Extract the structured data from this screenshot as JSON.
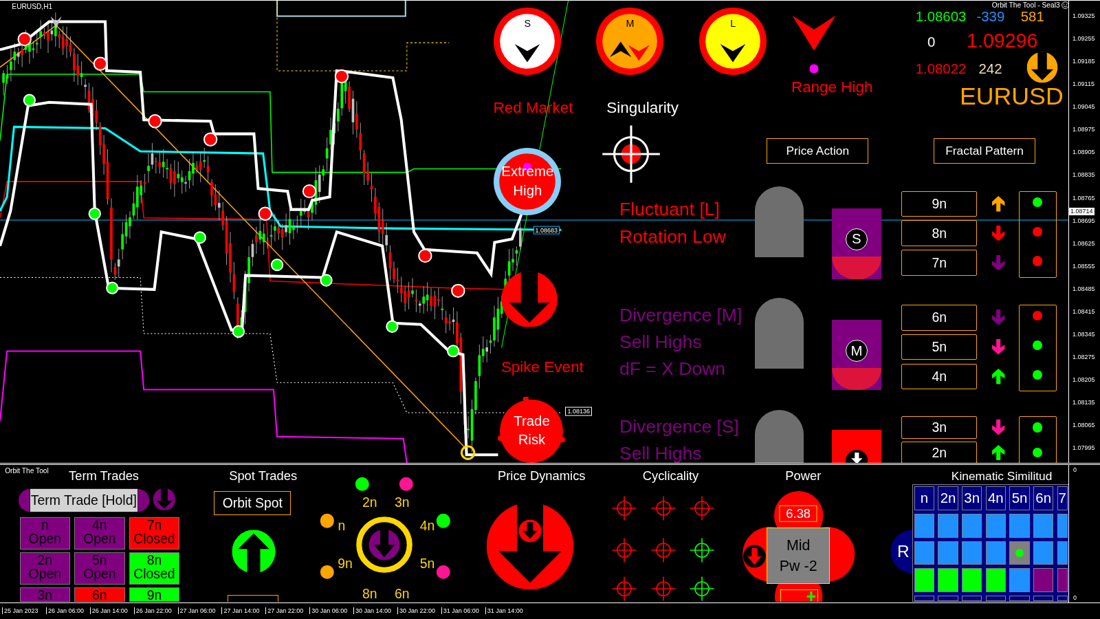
{
  "chart": {
    "title": "EURUSD,H1",
    "brand": "Orbit The Tool - Seal3",
    "price_tags": [
      "1.08683",
      "1.08136"
    ]
  },
  "dials": [
    {
      "label": "S",
      "color": "#ffffff",
      "arrows": [
        {
          "rising": false,
          "color": "#000000"
        }
      ]
    },
    {
      "label": "M",
      "color": "#ffa500",
      "arrows": [
        {
          "rising": true,
          "color": "#000000"
        },
        {
          "rising": false,
          "color": "#ff0000"
        }
      ]
    },
    {
      "label": "L",
      "color": "#ffff00",
      "arrows": [
        {
          "rising": false,
          "color": "#000000"
        }
      ]
    }
  ],
  "range_high": {
    "label": "Range High"
  },
  "captions": [
    {
      "text": "Red Market",
      "color": "#ff0000"
    },
    {
      "text": "Singularity",
      "color": "#ffffff"
    },
    {
      "text": "Spike Event",
      "color": "#ff0000"
    }
  ],
  "stats": [
    {
      "text": "1.08603",
      "color": "#00ff00"
    },
    {
      "text": "-339",
      "color": "#1e90ff"
    },
    {
      "text": "581",
      "color": "#ffa500"
    },
    {
      "text": "0",
      "color": "#ffffff"
    },
    {
      "text": "1.09296",
      "color": "#ff0000"
    },
    {
      "text": "1.08022",
      "color": "#ff0000"
    },
    {
      "text": "242",
      "color": "#f5deb3"
    }
  ],
  "symbol": {
    "name": "EURUSD",
    "rising": false
  },
  "buttons": [
    "Price Action",
    "Fractal Pattern"
  ],
  "markers": [
    {
      "text": "Extreme High",
      "kind": "ring"
    },
    {
      "text": "Trade Risk",
      "kind": "blob"
    }
  ],
  "signals": [
    {
      "lines": [
        "Fluctuant [L]",
        "Rotation Low"
      ],
      "color": "#ff0000",
      "badge": {
        "letter": "S",
        "color": "#800080"
      },
      "levels": [
        {
          "label": "9n",
          "arrow": {
            "rising": true,
            "color": "#ffa500"
          },
          "dot": {
            "color": "#00ff00"
          }
        },
        {
          "label": "8n",
          "arrow": {
            "rising": false,
            "color": "#ff0000"
          },
          "dot": {
            "color": "#ff0000"
          }
        },
        {
          "label": "7n",
          "arrow": {
            "rising": false,
            "color": "#800080"
          },
          "dot": {
            "color": "#ff0000"
          }
        }
      ]
    },
    {
      "lines": [
        "Divergence [M]",
        "Sell Highs",
        "dF = X Down"
      ],
      "color": "#800080",
      "badge": {
        "letter": "M",
        "color": "#800080"
      },
      "levels": [
        {
          "label": "6n",
          "arrow": {
            "rising": false,
            "color": "#800080"
          },
          "dot": {
            "color": "#ff0000"
          }
        },
        {
          "label": "5n",
          "arrow": {
            "rising": false,
            "color": "#ff1493"
          },
          "dot": {
            "color": "#00ff00"
          }
        },
        {
          "label": "4n",
          "arrow": {
            "rising": true,
            "color": "#00ff00"
          },
          "dot": {
            "color": "#00ff00"
          }
        }
      ]
    },
    {
      "lines": [
        "Divergence [S]",
        "Sell Highs"
      ],
      "color": "#800080",
      "badge": {
        "color": "#ff0000"
      },
      "levels": [
        {
          "label": "3n",
          "arrow": {
            "rising": false,
            "color": "#ff1493"
          },
          "dot": {
            "color": "#00ff00"
          }
        },
        {
          "label": "2n",
          "arrow": {
            "rising": true,
            "color": "#00ff00"
          },
          "dot": {
            "color": "#00ff00"
          }
        }
      ]
    }
  ],
  "price_axis": {
    "ticks": [
      "1.09325",
      "1.09255",
      "1.09185",
      "1.09115",
      "1.09045",
      "1.08975",
      "1.08905",
      "1.08835",
      "1.08765",
      "1.08695",
      "1.08625",
      "1.08555",
      "1.08485",
      "1.08415",
      "1.08345",
      "1.08275",
      "1.08205",
      "1.08135",
      "1.08065",
      "1.07995"
    ],
    "current": "1.08714"
  },
  "time_axis": [
    "25 Jan 2023",
    "26 Jan 06:00",
    "26 Jan 14:00",
    "26 Jan 22:00",
    "27 Jan 06:00",
    "27 Jan 14:00",
    "27 Jan 22:00",
    "30 Jan 06:00",
    "30 Jan 14:00",
    "30 Jan 22:00",
    "31 Jan 06:00",
    "31 Jan 14:00"
  ],
  "indicator": {
    "title": "Orbit The Tool",
    "scale": [
      "0",
      "0"
    ],
    "term_trades": {
      "title": "Term Trades",
      "button": "Term Trade [Hold]",
      "cells": [
        {
          "label": "n",
          "status": "Open",
          "color": "#800080"
        },
        {
          "label": "4n",
          "status": "Open",
          "color": "#800080"
        },
        {
          "label": "7n",
          "status": "Closed",
          "color": "#ff0000"
        },
        {
          "label": "2n",
          "status": "Open",
          "color": "#800080"
        },
        {
          "label": "5n",
          "status": "Open",
          "color": "#800080"
        },
        {
          "label": "8n",
          "status": "Closed",
          "color": "#00ff00"
        },
        {
          "label": "3n",
          "color": "#800080"
        },
        {
          "label": "6n",
          "color": "#ff0000"
        },
        {
          "label": "9n",
          "color": "#00ff00"
        }
      ]
    },
    "spot_trades": {
      "title": "Spot Trades",
      "button": "Orbit Spot",
      "rising": true
    },
    "orbit": {
      "nodes": [
        {
          "label": "n",
          "color": "#ffa500"
        },
        {
          "label": "2n",
          "color": "#00ff00"
        },
        {
          "label": "3n",
          "color": "#ff1493"
        },
        {
          "label": "4n",
          "color": "#00ff00"
        },
        {
          "label": "5n",
          "color": "#ff1493"
        },
        {
          "label": "6n"
        },
        {
          "label": "8n"
        },
        {
          "label": "9n",
          "color": "#ffa500"
        }
      ]
    },
    "price_dynamics": {
      "title": "Price Dynamics"
    },
    "cyclicality": {
      "title": "Cyclicality",
      "targets": [
        {
          "color": "#ff0000"
        },
        {
          "color": "#ff0000"
        },
        {
          "color": "#ff0000"
        },
        {
          "color": "#ff0000"
        },
        {
          "color": "#ff0000"
        },
        {
          "color": "#00ff00"
        },
        {
          "color": "#ff0000"
        },
        {
          "color": "#ff0000"
        },
        {
          "color": "#00ff00"
        }
      ]
    },
    "power": {
      "title": "Power",
      "value": "6.38",
      "state": "Mid Pw -2"
    },
    "kinematic": {
      "title": "Kinematic Similitud",
      "badge": "R",
      "columns": [
        "n",
        "2n",
        "3n",
        "4n",
        "5n",
        "6n",
        "7"
      ],
      "rows": [
        [
          {
            "color": "#1e90ff",
            "marked": false
          },
          {
            "color": "#1e90ff",
            "marked": false
          },
          {
            "color": "#1e90ff",
            "marked": false
          },
          {
            "color": "#1e90ff",
            "marked": false
          },
          {
            "color": "#1e90ff",
            "marked": false
          },
          {
            "color": "#1e90ff",
            "marked": false
          },
          {
            "color": "#1e90ff",
            "marked": false
          }
        ],
        [
          {
            "color": "#1e90ff",
            "marked": false
          },
          {
            "color": "#1e90ff",
            "marked": false
          },
          {
            "color": "#1e90ff",
            "marked": false
          },
          {
            "color": "#1e90ff",
            "marked": false
          },
          {
            "color": "#808080",
            "marked": true
          },
          {
            "color": "#1e90ff",
            "marked": false
          },
          {
            "color": "#1e90ff",
            "marked": false
          }
        ],
        [
          {
            "color": "#00ff00",
            "marked": false
          },
          {
            "color": "#00ff00",
            "marked": false
          },
          {
            "color": "#00ff00",
            "marked": false
          },
          {
            "color": "#00ff00",
            "marked": false
          },
          {
            "color": "#1e90ff",
            "marked": false
          },
          {
            "color": "#800080",
            "marked": false
          },
          {
            "color": "#800080",
            "marked": false
          }
        ],
        [
          {
            "color": "#000080",
            "marked": false
          },
          {
            "color": "#000080",
            "marked": false
          },
          {
            "color": "#000080",
            "marked": false
          },
          {
            "color": "#000080",
            "marked": false
          },
          {
            "color": "#000080",
            "marked": false
          },
          {
            "color": "#000080",
            "marked": false
          },
          {
            "color": "#000080",
            "marked": false
          }
        ]
      ]
    }
  }
}
